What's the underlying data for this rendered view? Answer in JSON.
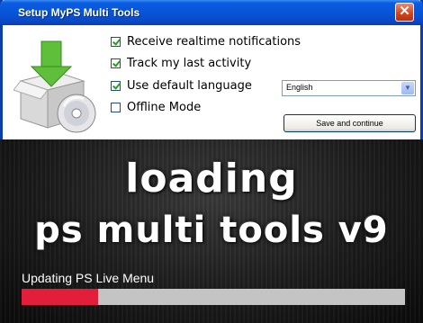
{
  "window": {
    "title": "Setup MyPS Multi Tools",
    "close_glyph": "✕"
  },
  "options": [
    {
      "label": "Receive realtime notifications",
      "checked": true
    },
    {
      "label": "Track my last activity",
      "checked": true
    },
    {
      "label": "Use default language",
      "checked": true
    },
    {
      "label": "Offline Mode",
      "checked": false
    }
  ],
  "language_select": {
    "value": "English"
  },
  "save_button": {
    "label": "Save and continue"
  },
  "loading_screen": {
    "line1": "loading",
    "line2": "ps multi tools v9",
    "status": "Updating PS Live Menu",
    "progress_fraction": 0.2,
    "progress_color": "#e31e3a"
  },
  "icons": {
    "install": "install-box-disc-icon",
    "close": "close-icon",
    "dropdown": "chevron-down-icon"
  }
}
